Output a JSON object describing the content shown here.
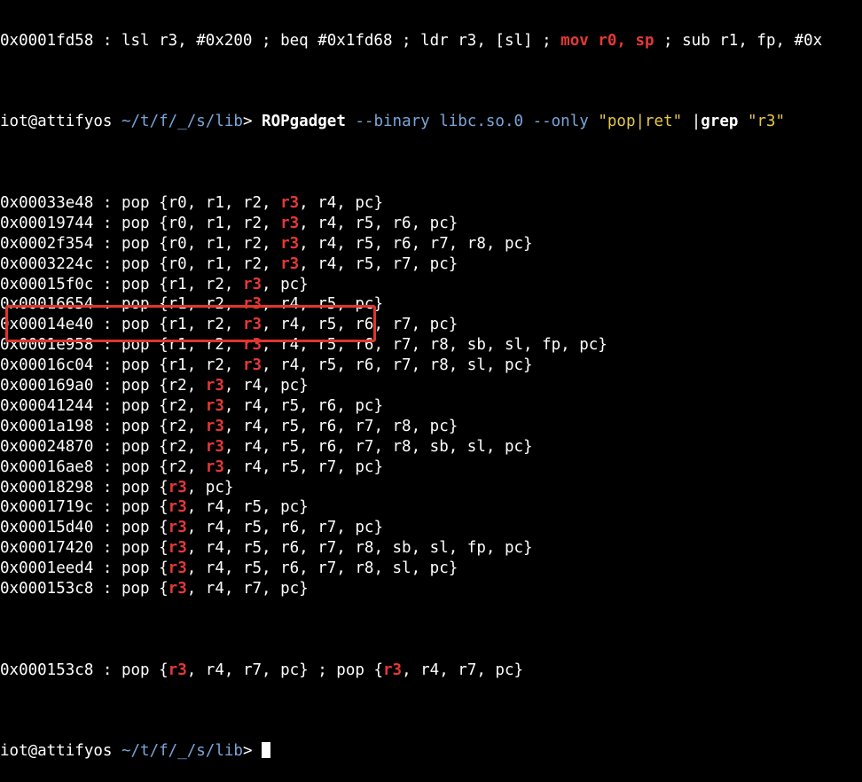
{
  "top_partial": {
    "before": "0x0001fd58 : lsl r3, #0x200 ; beq #0x1fd68 ; ldr r3, [sl] ; ",
    "red": "mov r0, sp",
    "after": " ; sub r1, fp, #0x"
  },
  "prompt": {
    "user": "iot@attifyos",
    "path": " ~/t/f/_/s/lib",
    "gt": "> ",
    "command": "ROPgadget",
    "args": " --binary libc.so.0 --only ",
    "string1": "\"pop|ret\"",
    "pipe": " |",
    "grep": "grep",
    "space": " ",
    "string2": "\"r3\""
  },
  "rows": [
    {
      "addr": "0x00033e48",
      "pre": " : pop {r0, r1, r2, ",
      "reg": "r3",
      "post": ", r4, pc}"
    },
    {
      "addr": "0x00019744",
      "pre": " : pop {r0, r1, r2, ",
      "reg": "r3",
      "post": ", r4, r5, r6, pc}"
    },
    {
      "addr": "0x0002f354",
      "pre": " : pop {r0, r1, r2, ",
      "reg": "r3",
      "post": ", r4, r5, r6, r7, r8, pc}"
    },
    {
      "addr": "0x0003224c",
      "pre": " : pop {r0, r1, r2, ",
      "reg": "r3",
      "post": ", r4, r5, r7, pc}"
    },
    {
      "addr": "0x00015f0c",
      "pre": " : pop {r1, r2, ",
      "reg": "r3",
      "post": ", pc}"
    },
    {
      "addr": "0x00016654",
      "pre": " : pop {r1, r2, ",
      "reg": "r3",
      "post": ", r4, r5, pc}"
    },
    {
      "addr": "0x00014e40",
      "pre": " : pop {r1, r2, ",
      "reg": "r3",
      "post": ", r4, r5, r6, r7, pc}"
    },
    {
      "addr": "0x0001e958",
      "pre": " : pop {r1, r2, ",
      "reg": "r3",
      "post": ", r4, r5, r6, r7, r8, sb, sl, fp, pc}"
    },
    {
      "addr": "0x00016c04",
      "pre": " : pop {r1, r2, ",
      "reg": "r3",
      "post": ", r4, r5, r6, r7, r8, sl, pc}"
    },
    {
      "addr": "0x000169a0",
      "pre": " : pop {r2, ",
      "reg": "r3",
      "post": ", r4, pc}"
    },
    {
      "addr": "0x00041244",
      "pre": " : pop {r2, ",
      "reg": "r3",
      "post": ", r4, r5, r6, pc}"
    },
    {
      "addr": "0x0001a198",
      "pre": " : pop {r2, ",
      "reg": "r3",
      "post": ", r4, r5, r6, r7, r8, pc}"
    },
    {
      "addr": "0x00024870",
      "pre": " : pop {r2, ",
      "reg": "r3",
      "post": ", r4, r5, r6, r7, r8, sb, sl, pc}"
    },
    {
      "addr": "0x00016ae8",
      "pre": " : pop {r2, ",
      "reg": "r3",
      "post": ", r4, r5, r7, pc}"
    },
    {
      "addr": "0x00018298",
      "pre": " : pop {",
      "reg": "r3",
      "post": ", pc}"
    },
    {
      "addr": "0x0001719c",
      "pre": " : pop {",
      "reg": "r3",
      "post": ", r4, r5, pc}"
    },
    {
      "addr": "0x00015d40",
      "pre": " : pop {",
      "reg": "r3",
      "post": ", r4, r5, r6, r7, pc}"
    },
    {
      "addr": "0x00017420",
      "pre": " : pop {",
      "reg": "r3",
      "post": ", r4, r5, r6, r7, r8, sb, sl, fp, pc}"
    },
    {
      "addr": "0x0001eed4",
      "pre": " : pop {",
      "reg": "r3",
      "post": ", r4, r5, r6, r7, r8, sl, pc}"
    },
    {
      "addr": "0x000153c8",
      "pre": " : pop {",
      "reg": "r3",
      "post": ", r4, r7, pc}"
    }
  ],
  "last_row": {
    "addr": "0x000153c8",
    "pre": " : pop {",
    "reg": "r3",
    "mid": ", r4, r7, pc} ; pop {",
    "reg2": "r3",
    "post": ", r4, r7, pc}"
  },
  "bottom_partial": {
    "user": "iot@attifyos",
    "path": " ~/t/f/_/s/lib",
    "gt": "> "
  },
  "colors": {
    "background": "#000000",
    "text": "#ffffff",
    "match": "#e53935",
    "path": "#7aa6da",
    "string": "#e6c84a",
    "highlight_box": "#e0352b"
  }
}
